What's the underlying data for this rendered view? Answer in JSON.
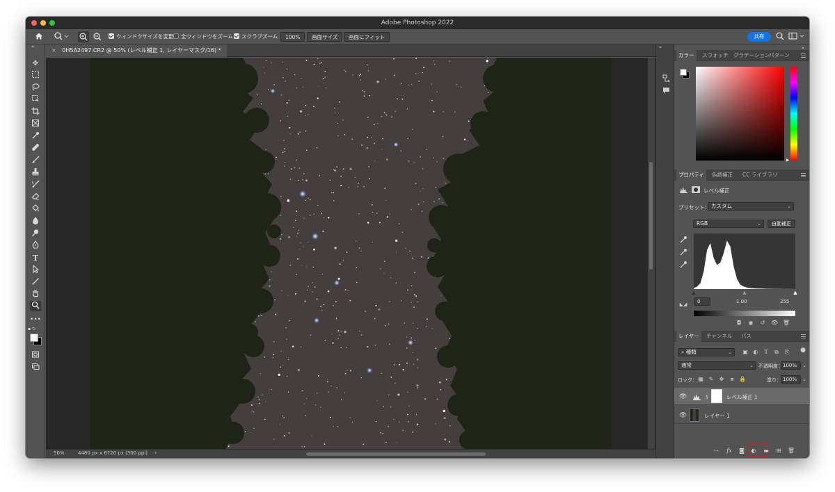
{
  "app": {
    "title": "Adobe Photoshop 2022"
  },
  "optionsbar": {
    "cb_resize_window": "ウィンドウサイズを変更",
    "cb_zoom_all": "全ウィンドウをズーム",
    "cb_scrubby_zoom": "スクラブズーム",
    "zoom_percent": "100%",
    "btn_fit_screen": "画面サイズ",
    "btn_fill_screen": "画面にフィット",
    "share_label": "共有"
  },
  "document": {
    "tab_title": "0H5A2497.CR2 @ 50% (レベル補正 1, レイヤーマスク/16) *"
  },
  "statusbar": {
    "zoom": "50%",
    "doc_info": "4480 px x 6720 px (300 ppi)",
    "arrow": "›"
  },
  "color_panel": {
    "tabs": [
      "カラー",
      "スウォッチ",
      "グラデーション",
      "パターン"
    ]
  },
  "properties_panel": {
    "tabs": [
      "プロパティ",
      "色調補正",
      "CC ライブラリ"
    ],
    "adjustment_title": "レベル補正",
    "preset_label": "プリセット：",
    "preset_value": "カスタム",
    "channel_value": "RGB",
    "auto_button": "自動補正",
    "input_black": "0",
    "input_gamma": "1.00",
    "input_white": "255",
    "histogram": [
      0.02,
      0.05,
      0.12,
      0.35,
      0.78,
      0.92,
      0.62,
      0.48,
      0.53,
      0.72,
      0.97,
      0.85,
      0.45,
      0.2,
      0.09,
      0.05,
      0.03,
      0.02,
      0.015,
      0.01,
      0.01,
      0.008,
      0.006,
      0.005,
      0.004,
      0.003,
      0.003,
      0.002,
      0.002,
      0.001
    ]
  },
  "layers_panel": {
    "tabs": [
      "レイヤー",
      "チャンネル",
      "パス"
    ],
    "filter_kind": "種類",
    "blend_mode": "通常",
    "opacity_label": "不透明度：",
    "opacity_value": "100%",
    "lock_label": "ロック：",
    "fill_label": "塗り：",
    "fill_value": "100%",
    "layers": [
      {
        "name": "レベル補正 1"
      },
      {
        "name": "レイヤー 1"
      }
    ]
  },
  "colors": {
    "accent": "#1473e6",
    "highlight_box": "#e8141e",
    "panel_bg": "#535353",
    "canvas_bg": "#282828",
    "sky": "#463e3e"
  }
}
